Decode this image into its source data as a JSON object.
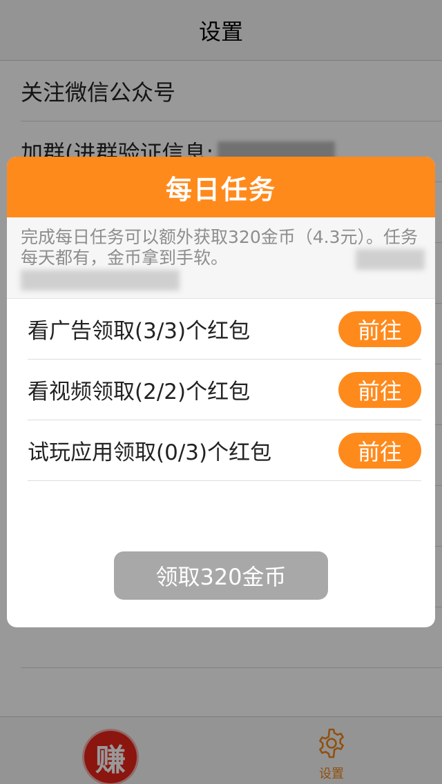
{
  "navbar": {
    "title": "设置"
  },
  "settings": {
    "items": [
      {
        "label": "关注微信公众号"
      },
      {
        "label": "加群(进群验证信息:"
      },
      {
        "label": ""
      },
      {
        "label": ""
      },
      {
        "label": ""
      },
      {
        "label": ""
      },
      {
        "label": ""
      },
      {
        "label": ""
      },
      {
        "label": ""
      },
      {
        "label": ""
      }
    ]
  },
  "modal": {
    "title": "每日任务",
    "description": "完成每日任务可以额外获取320金币（4.3元）。任务每天都有，金币拿到手软。",
    "tasks": [
      {
        "label": "看广告领取(3/3)个红包",
        "button": "前往"
      },
      {
        "label": "看视频领取(2/2)个红包",
        "button": "前往"
      },
      {
        "label": "试玩应用领取(0/3)个红包",
        "button": "前往"
      }
    ],
    "claim_button": "领取320金币"
  },
  "tabbar": {
    "earn_glyph": "赚",
    "settings_label": "设置",
    "settings_icon": "gear-icon"
  },
  "colors": {
    "accent": "#ff8a1c",
    "earn_red": "#e8231a",
    "disabled": "#a8a8a8"
  }
}
